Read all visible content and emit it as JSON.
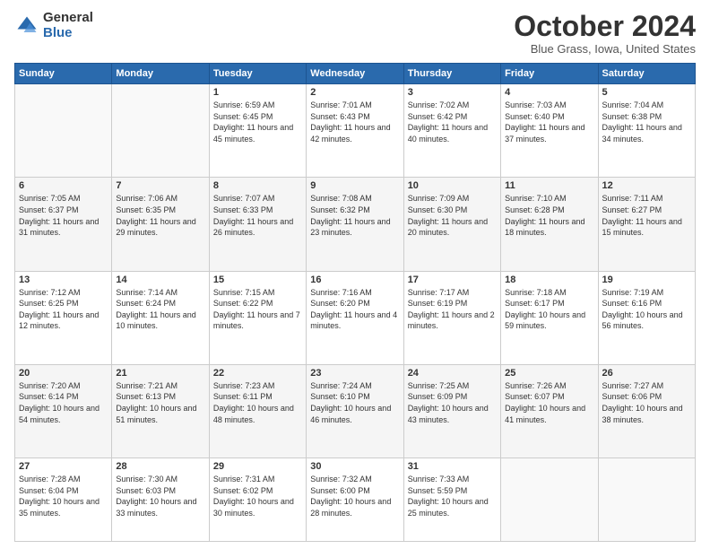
{
  "logo": {
    "general": "General",
    "blue": "Blue"
  },
  "header": {
    "month": "October 2024",
    "location": "Blue Grass, Iowa, United States"
  },
  "weekdays": [
    "Sunday",
    "Monday",
    "Tuesday",
    "Wednesday",
    "Thursday",
    "Friday",
    "Saturday"
  ],
  "weeks": [
    [
      {
        "day": "",
        "info": ""
      },
      {
        "day": "",
        "info": ""
      },
      {
        "day": "1",
        "info": "Sunrise: 6:59 AM\nSunset: 6:45 PM\nDaylight: 11 hours and 45 minutes."
      },
      {
        "day": "2",
        "info": "Sunrise: 7:01 AM\nSunset: 6:43 PM\nDaylight: 11 hours and 42 minutes."
      },
      {
        "day": "3",
        "info": "Sunrise: 7:02 AM\nSunset: 6:42 PM\nDaylight: 11 hours and 40 minutes."
      },
      {
        "day": "4",
        "info": "Sunrise: 7:03 AM\nSunset: 6:40 PM\nDaylight: 11 hours and 37 minutes."
      },
      {
        "day": "5",
        "info": "Sunrise: 7:04 AM\nSunset: 6:38 PM\nDaylight: 11 hours and 34 minutes."
      }
    ],
    [
      {
        "day": "6",
        "info": "Sunrise: 7:05 AM\nSunset: 6:37 PM\nDaylight: 11 hours and 31 minutes."
      },
      {
        "day": "7",
        "info": "Sunrise: 7:06 AM\nSunset: 6:35 PM\nDaylight: 11 hours and 29 minutes."
      },
      {
        "day": "8",
        "info": "Sunrise: 7:07 AM\nSunset: 6:33 PM\nDaylight: 11 hours and 26 minutes."
      },
      {
        "day": "9",
        "info": "Sunrise: 7:08 AM\nSunset: 6:32 PM\nDaylight: 11 hours and 23 minutes."
      },
      {
        "day": "10",
        "info": "Sunrise: 7:09 AM\nSunset: 6:30 PM\nDaylight: 11 hours and 20 minutes."
      },
      {
        "day": "11",
        "info": "Sunrise: 7:10 AM\nSunset: 6:28 PM\nDaylight: 11 hours and 18 minutes."
      },
      {
        "day": "12",
        "info": "Sunrise: 7:11 AM\nSunset: 6:27 PM\nDaylight: 11 hours and 15 minutes."
      }
    ],
    [
      {
        "day": "13",
        "info": "Sunrise: 7:12 AM\nSunset: 6:25 PM\nDaylight: 11 hours and 12 minutes."
      },
      {
        "day": "14",
        "info": "Sunrise: 7:14 AM\nSunset: 6:24 PM\nDaylight: 11 hours and 10 minutes."
      },
      {
        "day": "15",
        "info": "Sunrise: 7:15 AM\nSunset: 6:22 PM\nDaylight: 11 hours and 7 minutes."
      },
      {
        "day": "16",
        "info": "Sunrise: 7:16 AM\nSunset: 6:20 PM\nDaylight: 11 hours and 4 minutes."
      },
      {
        "day": "17",
        "info": "Sunrise: 7:17 AM\nSunset: 6:19 PM\nDaylight: 11 hours and 2 minutes."
      },
      {
        "day": "18",
        "info": "Sunrise: 7:18 AM\nSunset: 6:17 PM\nDaylight: 10 hours and 59 minutes."
      },
      {
        "day": "19",
        "info": "Sunrise: 7:19 AM\nSunset: 6:16 PM\nDaylight: 10 hours and 56 minutes."
      }
    ],
    [
      {
        "day": "20",
        "info": "Sunrise: 7:20 AM\nSunset: 6:14 PM\nDaylight: 10 hours and 54 minutes."
      },
      {
        "day": "21",
        "info": "Sunrise: 7:21 AM\nSunset: 6:13 PM\nDaylight: 10 hours and 51 minutes."
      },
      {
        "day": "22",
        "info": "Sunrise: 7:23 AM\nSunset: 6:11 PM\nDaylight: 10 hours and 48 minutes."
      },
      {
        "day": "23",
        "info": "Sunrise: 7:24 AM\nSunset: 6:10 PM\nDaylight: 10 hours and 46 minutes."
      },
      {
        "day": "24",
        "info": "Sunrise: 7:25 AM\nSunset: 6:09 PM\nDaylight: 10 hours and 43 minutes."
      },
      {
        "day": "25",
        "info": "Sunrise: 7:26 AM\nSunset: 6:07 PM\nDaylight: 10 hours and 41 minutes."
      },
      {
        "day": "26",
        "info": "Sunrise: 7:27 AM\nSunset: 6:06 PM\nDaylight: 10 hours and 38 minutes."
      }
    ],
    [
      {
        "day": "27",
        "info": "Sunrise: 7:28 AM\nSunset: 6:04 PM\nDaylight: 10 hours and 35 minutes."
      },
      {
        "day": "28",
        "info": "Sunrise: 7:30 AM\nSunset: 6:03 PM\nDaylight: 10 hours and 33 minutes."
      },
      {
        "day": "29",
        "info": "Sunrise: 7:31 AM\nSunset: 6:02 PM\nDaylight: 10 hours and 30 minutes."
      },
      {
        "day": "30",
        "info": "Sunrise: 7:32 AM\nSunset: 6:00 PM\nDaylight: 10 hours and 28 minutes."
      },
      {
        "day": "31",
        "info": "Sunrise: 7:33 AM\nSunset: 5:59 PM\nDaylight: 10 hours and 25 minutes."
      },
      {
        "day": "",
        "info": ""
      },
      {
        "day": "",
        "info": ""
      }
    ]
  ]
}
